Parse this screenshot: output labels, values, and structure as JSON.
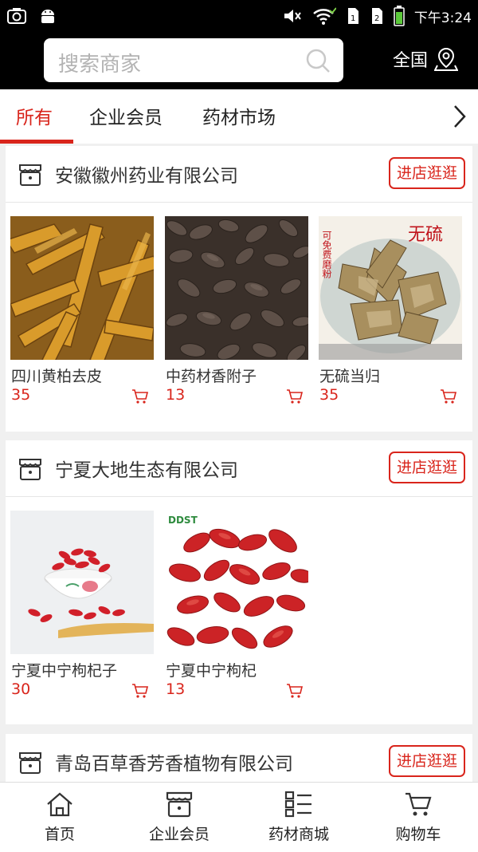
{
  "status_bar": {
    "time": "下午3:24"
  },
  "header": {
    "search_placeholder": "搜索商家",
    "region_label": "全国"
  },
  "tabs": [
    {
      "label": "所有",
      "active": true
    },
    {
      "label": "企业会员",
      "active": false
    },
    {
      "label": "药材市场",
      "active": false
    }
  ],
  "shops": [
    {
      "name": "安徽徽州药业有限公司",
      "visit_label": "进店逛逛",
      "products": [
        {
          "name": "四川黄柏去皮",
          "price": "35"
        },
        {
          "name": "中药材香附子",
          "price": "13"
        },
        {
          "name": "无硫当归",
          "price": "35",
          "image_text": "无硫",
          "image_side_text": "可免费磨粉"
        }
      ]
    },
    {
      "name": "宁夏大地生态有限公司",
      "visit_label": "进店逛逛",
      "products": [
        {
          "name": "宁夏中宁枸杞子",
          "price": "30"
        },
        {
          "name": "宁夏中宁枸杞",
          "price": "13",
          "image_logo": "DDST"
        }
      ]
    },
    {
      "name": "青岛百草香芳香植物有限公司",
      "visit_label": "进店逛逛",
      "products": []
    }
  ],
  "bottom_nav": [
    {
      "label": "首页",
      "icon": "home-icon"
    },
    {
      "label": "企业会员",
      "icon": "shop-icon"
    },
    {
      "label": "药材商城",
      "icon": "list-icon"
    },
    {
      "label": "购物车",
      "icon": "cart-icon"
    }
  ],
  "colors": {
    "accent": "#d9251c",
    "header_bg": "#000000",
    "page_bg": "#f0f0f0"
  }
}
